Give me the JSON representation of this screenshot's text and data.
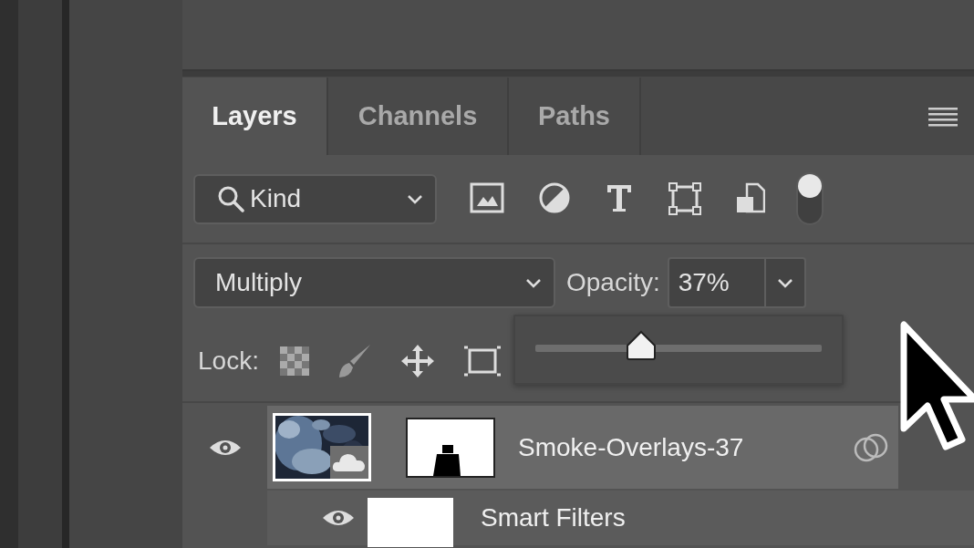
{
  "tabs": [
    {
      "label": "Layers",
      "selected": true
    },
    {
      "label": "Channels",
      "selected": false
    },
    {
      "label": "Paths",
      "selected": false
    }
  ],
  "filter": {
    "label": "Kind",
    "filtering_on": true
  },
  "blend_mode": {
    "value": "Multiply"
  },
  "opacity": {
    "label": "Opacity:",
    "value": "37%",
    "level": 0.37
  },
  "lock": {
    "label": "Lock:"
  },
  "layers": [
    {
      "name": "Smoke-Overlays-37",
      "kind": "smart-object",
      "visible": true,
      "selected": true
    },
    {
      "name": "Smart Filters",
      "kind": "smart-filters",
      "visible": true,
      "selected": false
    }
  ]
}
